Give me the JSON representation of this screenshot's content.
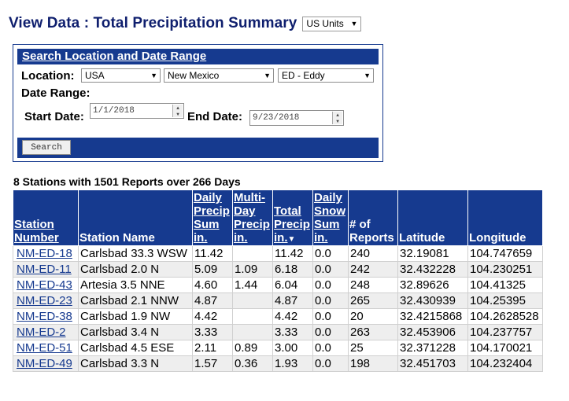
{
  "page": {
    "title": "View Data : Total Precipitation Summary",
    "units": "US Units"
  },
  "search": {
    "header": "Search Location and Date Range",
    "location_label": "Location:",
    "country": "USA",
    "state": "New Mexico",
    "county": "ED - Eddy",
    "date_range_label": "Date Range:",
    "start_label": "Start Date:",
    "start_value": "1/1/2018",
    "end_label": "End Date:",
    "end_value": "9/23/2018",
    "button": "Search"
  },
  "summary": "8 Stations with 1501 Reports over 266 Days",
  "table": {
    "headers": {
      "station_number": "Station Number",
      "station_name": "Station Name",
      "daily_precip": "Daily Precip Sum in.",
      "multi_day": "Multi- Day Precip in.",
      "total_precip": "Total Precip in.",
      "daily_snow": "Daily Snow Sum in.",
      "reports": "# of Reports",
      "latitude": "Latitude",
      "longitude": "Longitude"
    },
    "rows": [
      {
        "num": "NM-ED-18",
        "name": "Carlsbad 33.3 WSW",
        "daily": "11.42",
        "multi": "",
        "total": "11.42",
        "snow": "0.0",
        "reports": "240",
        "lat": "32.19081",
        "lon": "104.747659"
      },
      {
        "num": "NM-ED-11",
        "name": "Carlsbad 2.0 N",
        "daily": "5.09",
        "multi": "1.09",
        "total": "6.18",
        "snow": "0.0",
        "reports": "242",
        "lat": "32.432228",
        "lon": "104.230251"
      },
      {
        "num": "NM-ED-43",
        "name": "Artesia 3.5 NNE",
        "daily": "4.60",
        "multi": "1.44",
        "total": "6.04",
        "snow": "0.0",
        "reports": "248",
        "lat": "32.89626",
        "lon": "104.41325"
      },
      {
        "num": "NM-ED-23",
        "name": "Carlsbad 2.1 NNW",
        "daily": "4.87",
        "multi": "",
        "total": "4.87",
        "snow": "0.0",
        "reports": "265",
        "lat": "32.430939",
        "lon": "104.25395"
      },
      {
        "num": "NM-ED-38",
        "name": "Carlsbad 1.9 NW",
        "daily": "4.42",
        "multi": "",
        "total": "4.42",
        "snow": "0.0",
        "reports": "20",
        "lat": "32.4215868",
        "lon": "104.2628528"
      },
      {
        "num": "NM-ED-2",
        "name": "Carlsbad 3.4 N",
        "daily": "3.33",
        "multi": "",
        "total": "3.33",
        "snow": "0.0",
        "reports": "263",
        "lat": "32.453906",
        "lon": "104.237757"
      },
      {
        "num": "NM-ED-51",
        "name": "Carlsbad 4.5 ESE",
        "daily": "2.11",
        "multi": "0.89",
        "total": "3.00",
        "snow": "0.0",
        "reports": "25",
        "lat": "32.371228",
        "lon": "104.170021"
      },
      {
        "num": "NM-ED-49",
        "name": "Carlsbad 3.3 N",
        "daily": "1.57",
        "multi": "0.36",
        "total": "1.93",
        "snow": "0.0",
        "reports": "198",
        "lat": "32.451703",
        "lon": "104.232404"
      }
    ]
  }
}
